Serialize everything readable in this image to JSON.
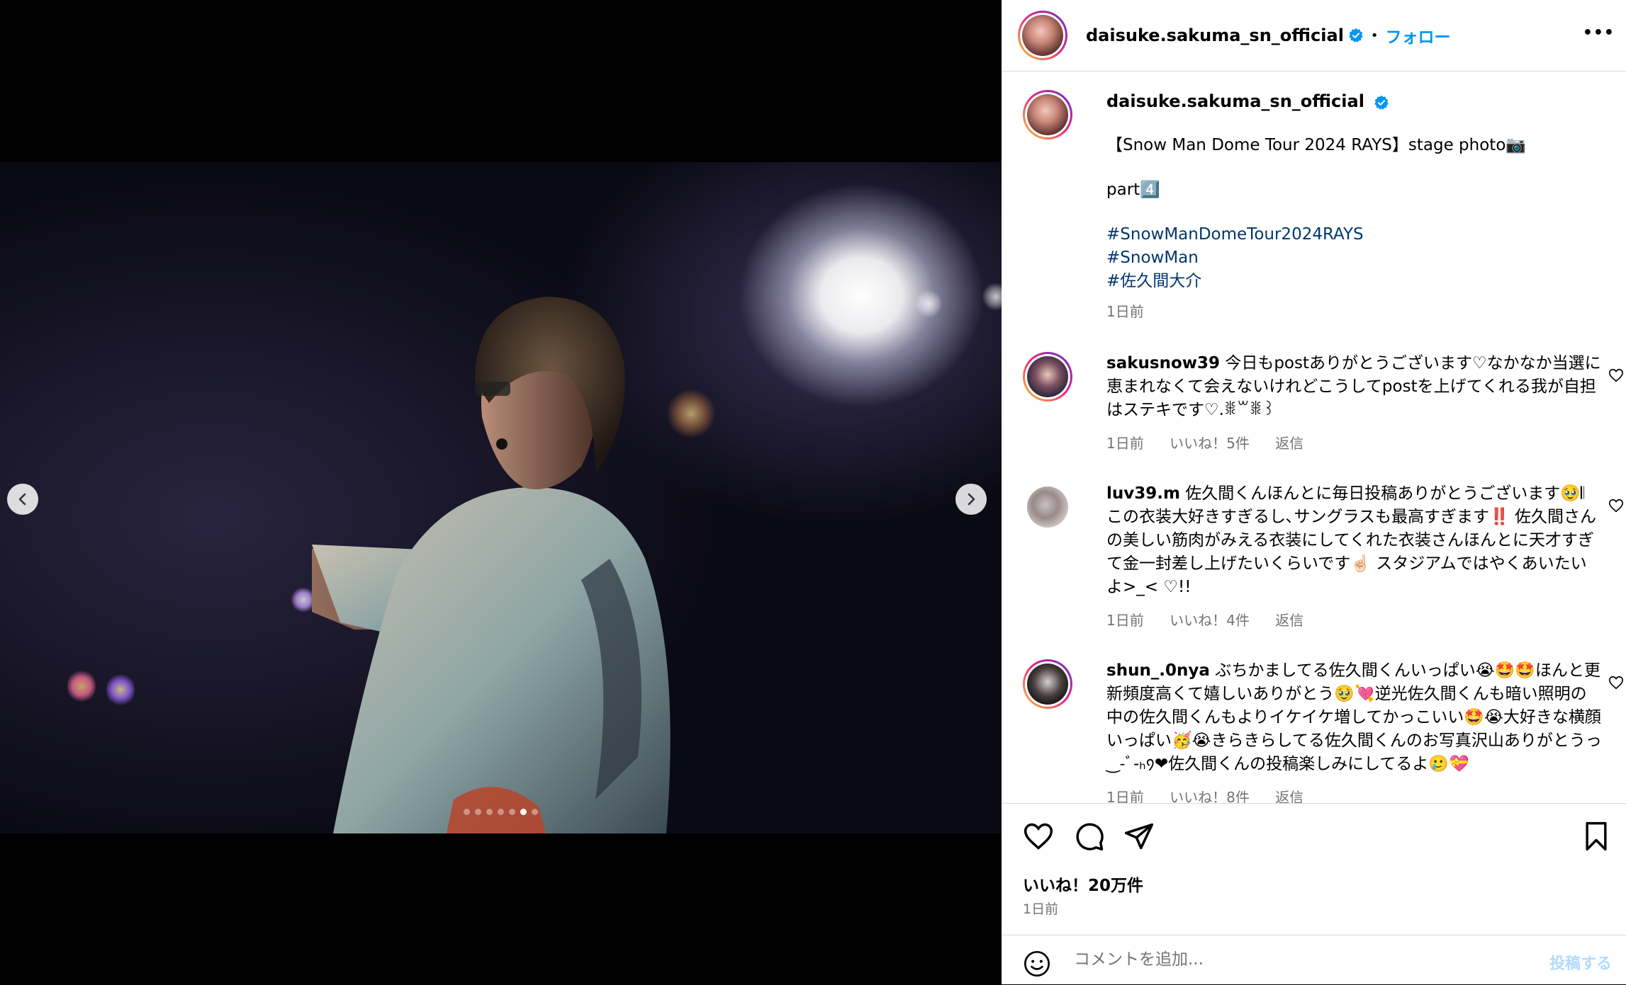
{
  "post": {
    "username": "daisuke.sakuma_sn_official",
    "follow_label": "フォロー",
    "separator": "•",
    "more_label": "•••"
  },
  "caption": {
    "username": "daisuke.sakuma_sn_official",
    "line1": "【Snow Man Dome Tour 2024 RAYS】stage photo📷",
    "line2": "part4️⃣",
    "hashtags": [
      "#SnowManDomeTour2024RAYS",
      "#SnowMan",
      "#佐久間大介"
    ],
    "time": "1日前"
  },
  "comments": [
    {
      "username": "sakusnow39",
      "text": "今日もpostありがとうございます♡なかなか当選に恵まれなくて会えないけれどこうしてpostを上げてくれる我が自担はステキです♡.ꒌ꒳ꒌ꒱",
      "time": "1日前",
      "likes": "いいね！5件",
      "reply": "返信"
    },
    {
      "username": "luv39.m",
      "text": "佐久間くんほんとに毎日投稿ありがとうございます🥹𝄃 この衣装大好きすぎるし､サングラスも最高すぎます‼️ 佐久間さんの美しい筋肉がみえる衣装にしてくれた衣装さんほんとに天才すぎて金一封差し上げたいくらいです☝🏻 スタジアムではやくあいたいよ>_< ♡!!",
      "time": "1日前",
      "likes": "いいね！4件",
      "reply": "返信"
    },
    {
      "username": "shun_.0nya",
      "text": "ぶちかましてる佐久間くんいっぱい😭🤩🤩ほんと更新頻度高くて嬉しいありがとう🥹💘逆光佐久間くんも暗い照明の中の佐久間くんもよりイケイケ増してかっこいい🤩😭大好きな横顔いっぱい🥳😭きらきらしてる佐久間くんのお写真沢山ありがとうっ‿-ﾞ-ₕ᠀❤佐久間くんの投稿楽しみにしてるよ🥲💝",
      "time": "1日前",
      "likes": "いいね！8件",
      "reply": "返信"
    }
  ],
  "footer": {
    "likes": "いいね！20万件",
    "date": "1日前",
    "comment_placeholder": "コメントを追加...",
    "post_label": "投稿する"
  },
  "carousel": {
    "total": 7,
    "active_index": 5
  },
  "colors": {
    "accent": "#0095f6",
    "link": "#00376b",
    "muted": "#737373",
    "verified": "#0095f6"
  }
}
